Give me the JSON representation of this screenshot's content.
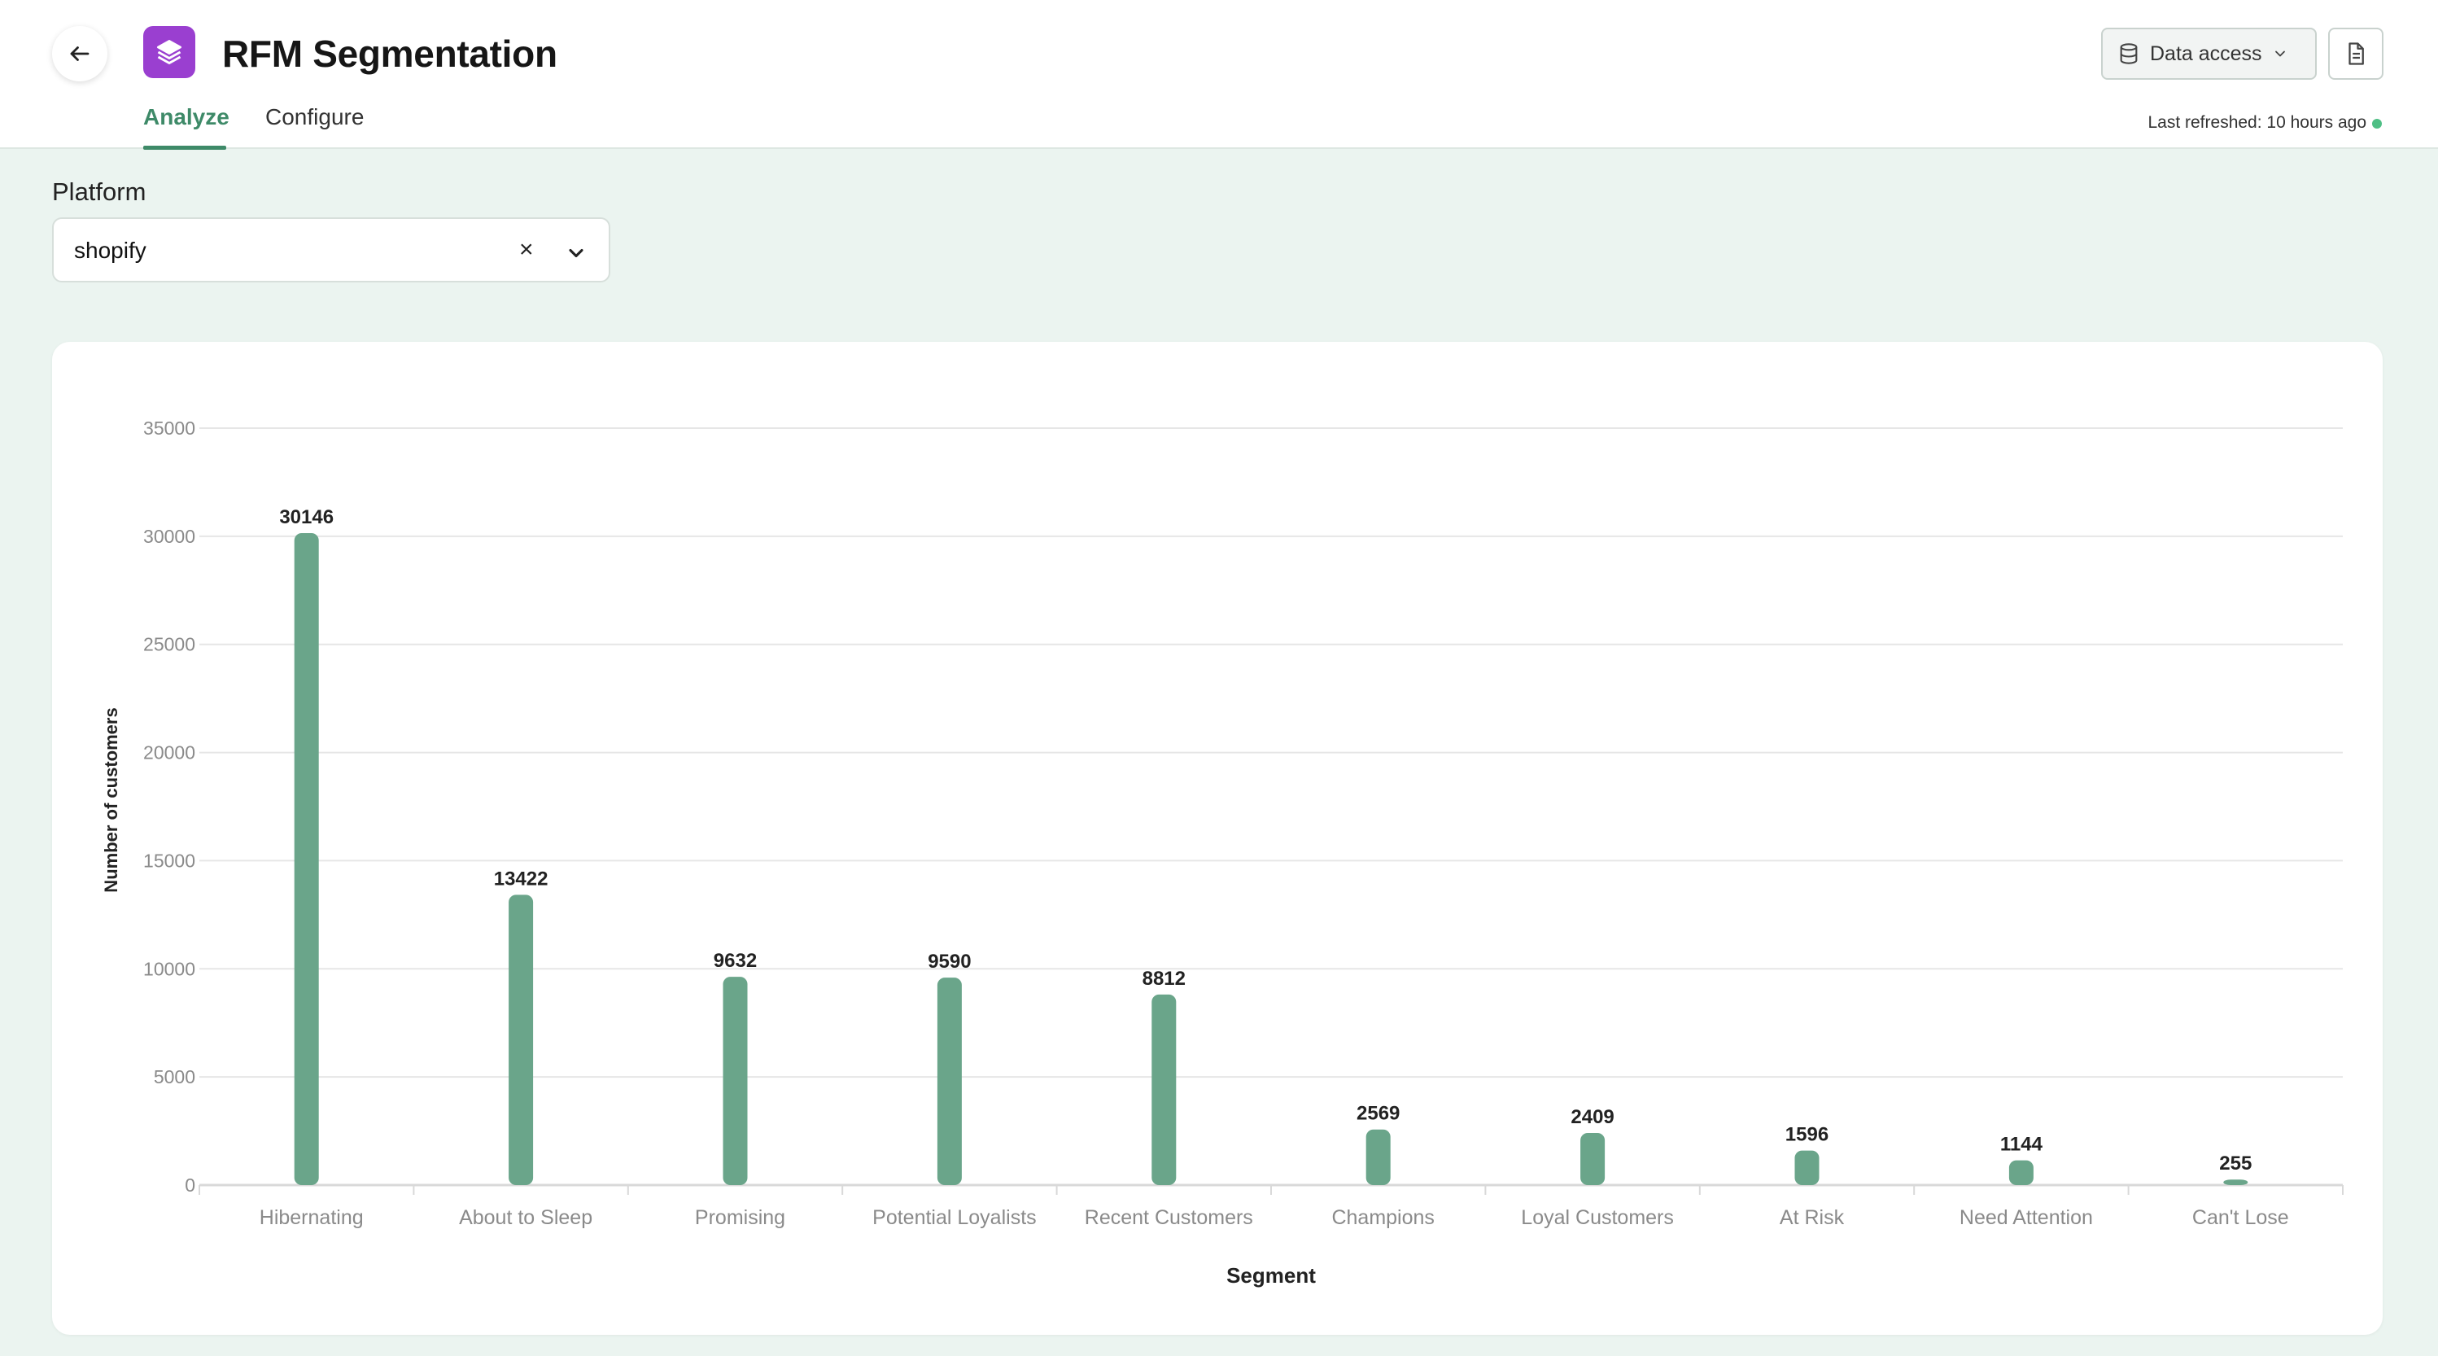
{
  "header": {
    "title": "RFM Segmentation",
    "tabs": [
      {
        "label": "Analyze",
        "active": true
      },
      {
        "label": "Configure",
        "active": false
      }
    ],
    "data_access_label": "Data access",
    "last_refreshed": "Last refreshed: 10 hours ago",
    "icons": {
      "back": "arrow-left-icon",
      "app": "layers-icon",
      "data_access": "database-icon",
      "document": "document-icon"
    }
  },
  "filter": {
    "label": "Platform",
    "value": "shopify"
  },
  "colors": {
    "accent": "#3e8a68",
    "bar": "#6aa58a",
    "app_icon": "#9a3fd0",
    "status_dot": "#4fbf85"
  },
  "chart_data": {
    "type": "bar",
    "categories": [
      "Hibernating",
      "About to Sleep",
      "Promising",
      "Potential Loyalists",
      "Recent Customers",
      "Champions",
      "Loyal Customers",
      "At Risk",
      "Need Attention",
      "Can't Lose"
    ],
    "values": [
      30146,
      13422,
      9632,
      9590,
      8812,
      2569,
      2409,
      1596,
      1144,
      255
    ],
    "xlabel": "Segment",
    "ylabel": "Number of customers",
    "ylim": [
      0,
      35000
    ],
    "yticks": [
      0,
      5000,
      10000,
      15000,
      20000,
      25000,
      30000,
      35000
    ],
    "grid": true,
    "data_labels": true
  }
}
